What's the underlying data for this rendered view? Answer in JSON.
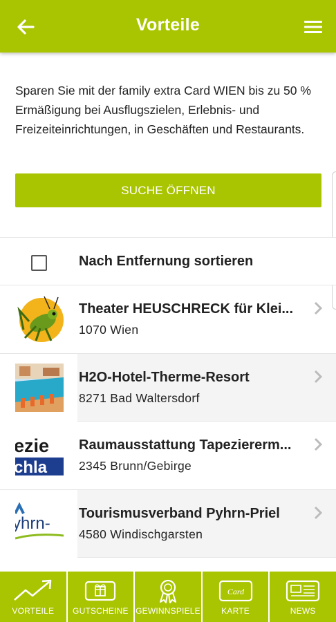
{
  "appbar": {
    "title": "Vorteile"
  },
  "intro": {
    "text": "Sparen Sie mit der family extra Card WIEN bis zu 50 % Ermäßigung bei Ausflugszielen, Erlebnis- und Freizeiteinrichtungen, in Geschäften und Restaurants."
  },
  "search": {
    "label": "SUCHE ÖFFNEN"
  },
  "sort": {
    "label": "Nach Entfernung sortieren",
    "checked": false
  },
  "items": [
    {
      "name": "Theater HEUSCHRECK für Klei...",
      "city": "1070 Wien",
      "logo": "grasshopper-logo"
    },
    {
      "name": "H2O-Hotel-Therme-Resort",
      "city": "8271 Bad Waltersdorf",
      "logo": "pool-photo"
    },
    {
      "name": "Raumausstattung Tapeziererm...",
      "city": "2345 Brunn/Gebirge",
      "logo": "tapezier-logo",
      "logo_text_1": "ezie",
      "logo_text_2": "chla"
    },
    {
      "name": "Tourismusverband Pyhrn-Priel",
      "city": "4580 Windischgarsten",
      "logo": "pyhrn-logo",
      "logo_text": "yhrn-"
    }
  ],
  "tabs": [
    {
      "label": "VORTEILE",
      "icon": "trend-arrow-icon"
    },
    {
      "label": "GUTSCHEINE",
      "icon": "gift-card-icon"
    },
    {
      "label": "GEWINNSPIELE",
      "icon": "award-ribbon-icon"
    },
    {
      "label": "KARTE",
      "icon": "card-icon",
      "icon_text": "Card"
    },
    {
      "label": "NEWS",
      "icon": "newspaper-icon"
    }
  ],
  "colors": {
    "accent": "#a9c400",
    "text": "#222222",
    "row_shade": "#f4f4f4"
  }
}
